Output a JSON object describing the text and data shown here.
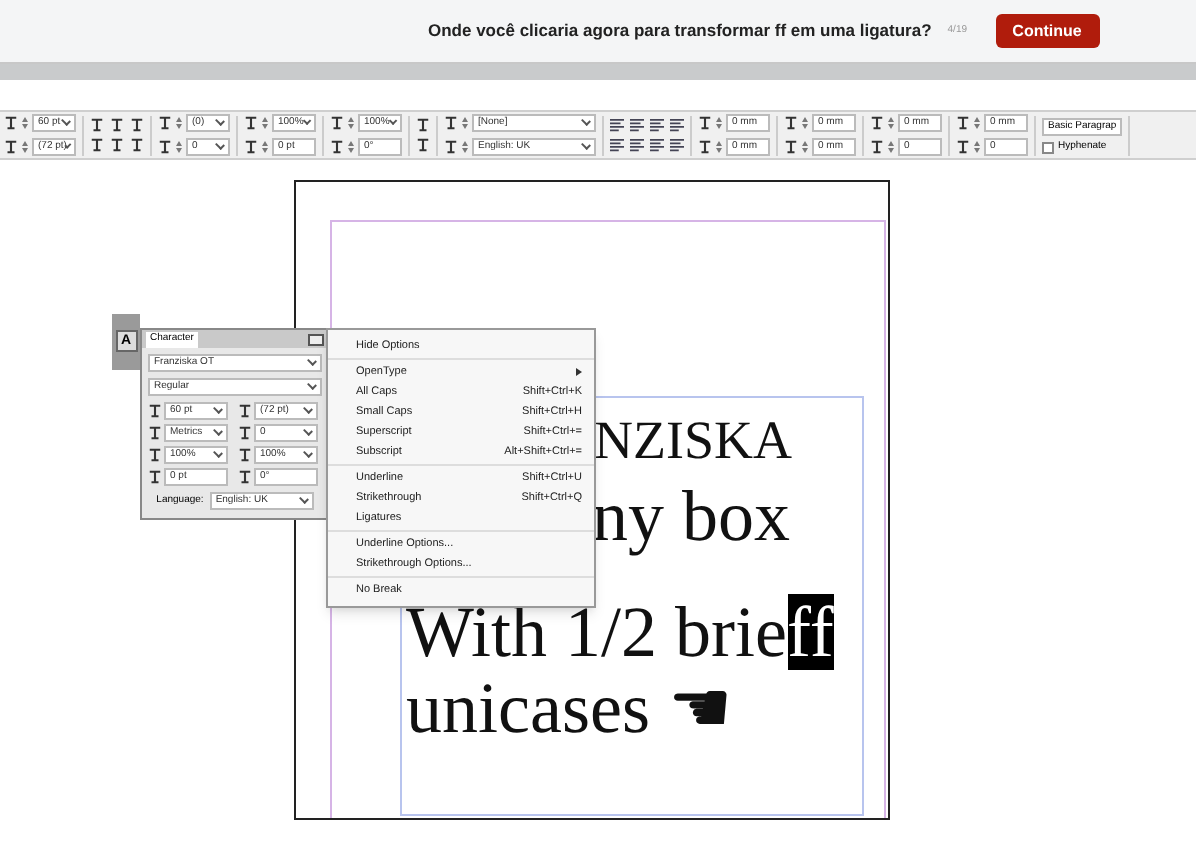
{
  "question_bar": {
    "question": "Onde você clicaria agora para transformar ff em uma ligatura?",
    "progress": "4/19",
    "button": "Continue"
  },
  "toolbar": {
    "groups": [
      {
        "kind": "fields",
        "items": [
          {
            "value": "60 pt",
            "dropdown": true
          },
          {
            "value": "(72 pt)",
            "dropdown": true
          }
        ]
      },
      {
        "kind": "icons"
      },
      {
        "kind": "fields",
        "items": [
          {
            "value": "(0)",
            "dropdown": true
          },
          {
            "value": "0",
            "dropdown": true
          }
        ]
      },
      {
        "kind": "fields",
        "items": [
          {
            "value": "100%",
            "dropdown": true
          },
          {
            "value": "0 pt",
            "dropdown": false
          }
        ]
      },
      {
        "kind": "fields",
        "items": [
          {
            "value": "100%",
            "dropdown": true
          },
          {
            "value": "0°",
            "dropdown": false
          }
        ]
      },
      {
        "kind": "icons"
      },
      {
        "kind": "fields",
        "items": [
          {
            "value": "[None]",
            "dropdown": true
          },
          {
            "value": "English: UK",
            "dropdown": true
          }
        ]
      },
      {
        "kind": "icons"
      },
      {
        "kind": "fields",
        "items": [
          {
            "value": "0 mm",
            "dropdown": false
          },
          {
            "value": "0 mm",
            "dropdown": false
          }
        ]
      },
      {
        "kind": "fields",
        "items": [
          {
            "value": "0 mm",
            "dropdown": false
          },
          {
            "value": "0 mm",
            "dropdown": false
          }
        ]
      },
      {
        "kind": "fields",
        "items": [
          {
            "value": "0 mm",
            "dropdown": false
          },
          {
            "value": "0",
            "dropdown": false
          }
        ]
      },
      {
        "kind": "fields",
        "items": [
          {
            "value": "0 mm",
            "dropdown": false
          },
          {
            "value": "0",
            "dropdown": false
          }
        ]
      },
      {
        "kind": "style",
        "style": "Basic Paragrap",
        "checkbox": {
          "label": "Hyphenate",
          "checked": false
        }
      }
    ]
  },
  "tool_strip": {
    "button": "A"
  },
  "character_panel": {
    "title": "Character",
    "font": "Franziska OT",
    "style": "Regular",
    "fields": [
      {
        "value": "60 pt",
        "dropdown": true
      },
      {
        "value": "(72 pt)",
        "dropdown": true
      },
      {
        "value": "Metrics",
        "dropdown": true
      },
      {
        "value": "0",
        "dropdown": true
      },
      {
        "value": "100%",
        "dropdown": true
      },
      {
        "value": "100%",
        "dropdown": true
      },
      {
        "value": "0 pt",
        "dropdown": false
      },
      {
        "value": "0°",
        "dropdown": false
      }
    ],
    "language_label": "Language:",
    "language": "English: UK"
  },
  "menu": {
    "sections": [
      [
        {
          "label": "Hide Options"
        }
      ],
      [
        {
          "label": "OpenType",
          "submenu": true
        },
        {
          "label": "All Caps",
          "shortcut": "Shift+Ctrl+K"
        },
        {
          "label": "Small Caps",
          "shortcut": "Shift+Ctrl+H"
        },
        {
          "label": "Superscript",
          "shortcut": "Shift+Ctrl+="
        },
        {
          "label": "Subscript",
          "shortcut": "Alt+Shift+Ctrl+="
        }
      ],
      [
        {
          "label": "Underline",
          "shortcut": "Shift+Ctrl+U"
        },
        {
          "label": "Strikethrough",
          "shortcut": "Shift+Ctrl+Q"
        },
        {
          "label": "Ligatures"
        }
      ],
      [
        {
          "label": "Underline Options..."
        },
        {
          "label": "Strikethrough Options..."
        }
      ],
      [
        {
          "label": "No Break"
        }
      ]
    ]
  },
  "document": {
    "lines": [
      {
        "text": "NZISKA"
      },
      {
        "text": "ny box"
      },
      {
        "text": "With 1/2 brie",
        "selected_text": "ff"
      },
      {
        "text": "unicases ☚"
      }
    ]
  }
}
